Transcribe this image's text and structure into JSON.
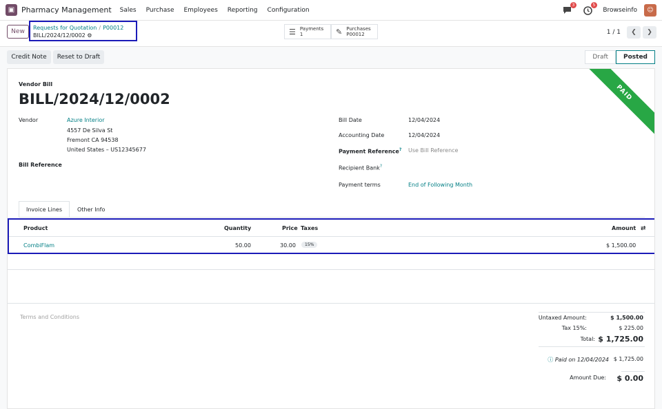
{
  "app": {
    "name": "Pharmacy Management",
    "menu": [
      "Sales",
      "Purchase",
      "Employees",
      "Reporting",
      "Configuration"
    ],
    "messages_badge": "3",
    "activities_badge": "5",
    "company": "Browseinfo"
  },
  "control_panel": {
    "new_label": "New",
    "breadcrumb": [
      "Requests for Quotation",
      "P00012"
    ],
    "current_record": "BILL/2024/12/0002",
    "smart_buttons": [
      {
        "label": "Payments",
        "value": "1"
      },
      {
        "label": "Purchases",
        "value": "P00012"
      }
    ],
    "pager": "1 / 1"
  },
  "actions": {
    "credit_note": "Credit Note",
    "reset_to_draft": "Reset to Draft"
  },
  "status": {
    "stages": [
      "Draft",
      "Posted"
    ],
    "current": "Posted"
  },
  "ribbon": "PAID",
  "document": {
    "type": "Vendor Bill",
    "name": "BILL/2024/12/0002",
    "vendor_label": "Vendor",
    "vendor_name": "Azure Interior",
    "vendor_address": [
      "4557 De Silva St",
      "Fremont CA 94538",
      "United States – US12345677"
    ],
    "bill_reference_label": "Bill Reference",
    "bill_date_label": "Bill Date",
    "bill_date": "12/04/2024",
    "accounting_date_label": "Accounting Date",
    "accounting_date": "12/04/2024",
    "payment_reference_label": "Payment Reference",
    "payment_reference_placeholder": "Use Bill Reference",
    "recipient_bank_label": "Recipient Bank",
    "payment_terms_label": "Payment terms",
    "payment_terms": "End of Following Month",
    "help_mark": "?"
  },
  "tabs": [
    "Invoice Lines",
    "Other Info"
  ],
  "invoice_lines": {
    "headers": {
      "product": "Product",
      "quantity": "Quantity",
      "price": "Price",
      "taxes": "Taxes",
      "amount": "Amount"
    },
    "rows": [
      {
        "product": "CombiFlam",
        "quantity": "50.00",
        "price": "30.00",
        "tax": "15%",
        "amount": "$ 1,500.00"
      }
    ]
  },
  "terms_placeholder": "Terms and Conditions",
  "totals": {
    "untaxed_label": "Untaxed Amount:",
    "untaxed": "$ 1,500.00",
    "tax_label": "Tax 15%:",
    "tax": "$ 225.00",
    "total_label": "Total:",
    "total": "$ 1,725.00",
    "paid_label": "Paid on 12/04/2024",
    "paid": "$ 1,725.00",
    "due_label": "Amount Due:",
    "due": "$ 0.00"
  }
}
